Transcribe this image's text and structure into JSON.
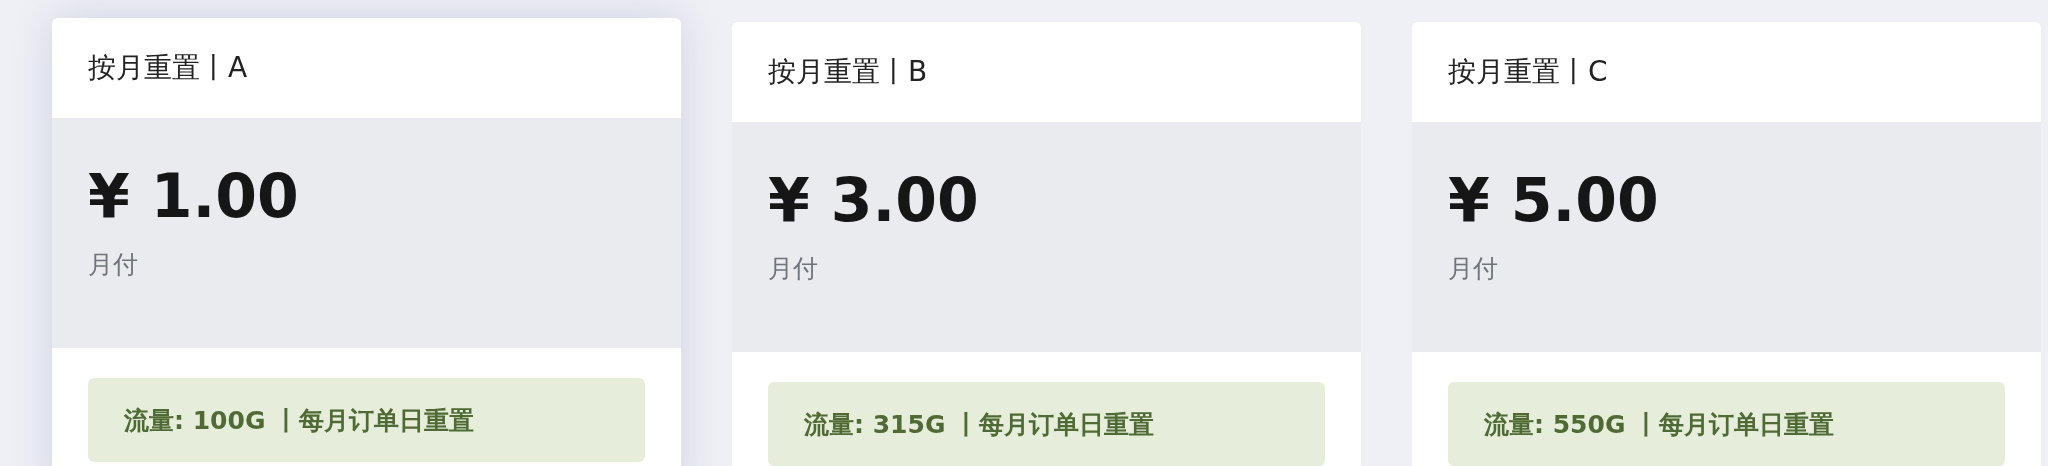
{
  "plans": [
    {
      "title": "按月重置丨A",
      "price": "¥ 1.00",
      "period": "月付",
      "feature": "流量: 100G 丨每月订单日重置",
      "hovered": true
    },
    {
      "title": "按月重置丨B",
      "price": "¥ 3.00",
      "period": "月付",
      "feature": "流量: 315G 丨每月订单日重置",
      "hovered": false
    },
    {
      "title": "按月重置丨C",
      "price": "¥ 5.00",
      "period": "月付",
      "feature": "流量: 550G 丨每月订单日重置",
      "hovered": false
    }
  ]
}
